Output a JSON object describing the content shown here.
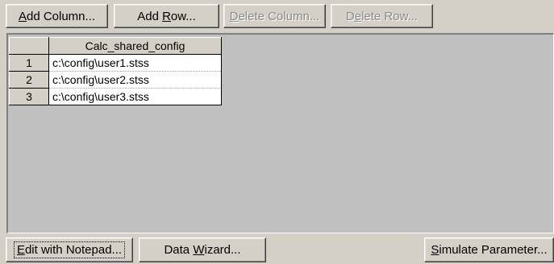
{
  "toolbar": {
    "add_column": {
      "pre": "",
      "hotkey": "A",
      "post": "dd Column..."
    },
    "add_row": {
      "pre": "Add ",
      "hotkey": "R",
      "post": "ow..."
    },
    "delete_column": {
      "pre": "",
      "hotkey": "D",
      "post": "elete Column..."
    },
    "delete_row": {
      "pre": "D",
      "hotkey": "e",
      "post": "lete Row..."
    }
  },
  "grid": {
    "column_header": "Calc_shared_config",
    "rows": [
      {
        "number": "1",
        "value": "c:\\config\\user1.stss"
      },
      {
        "number": "2",
        "value": "c:\\config\\user2.stss"
      },
      {
        "number": "3",
        "value": "c:\\config\\user3.stss"
      }
    ]
  },
  "footer": {
    "edit_notepad": {
      "pre": "",
      "hotkey": "E",
      "post": "dit with Notepad..."
    },
    "data_wizard": {
      "pre": "Data ",
      "hotkey": "W",
      "post": "izard..."
    },
    "simulate": {
      "pre": "",
      "hotkey": "S",
      "post": "imulate Parameter..."
    }
  }
}
